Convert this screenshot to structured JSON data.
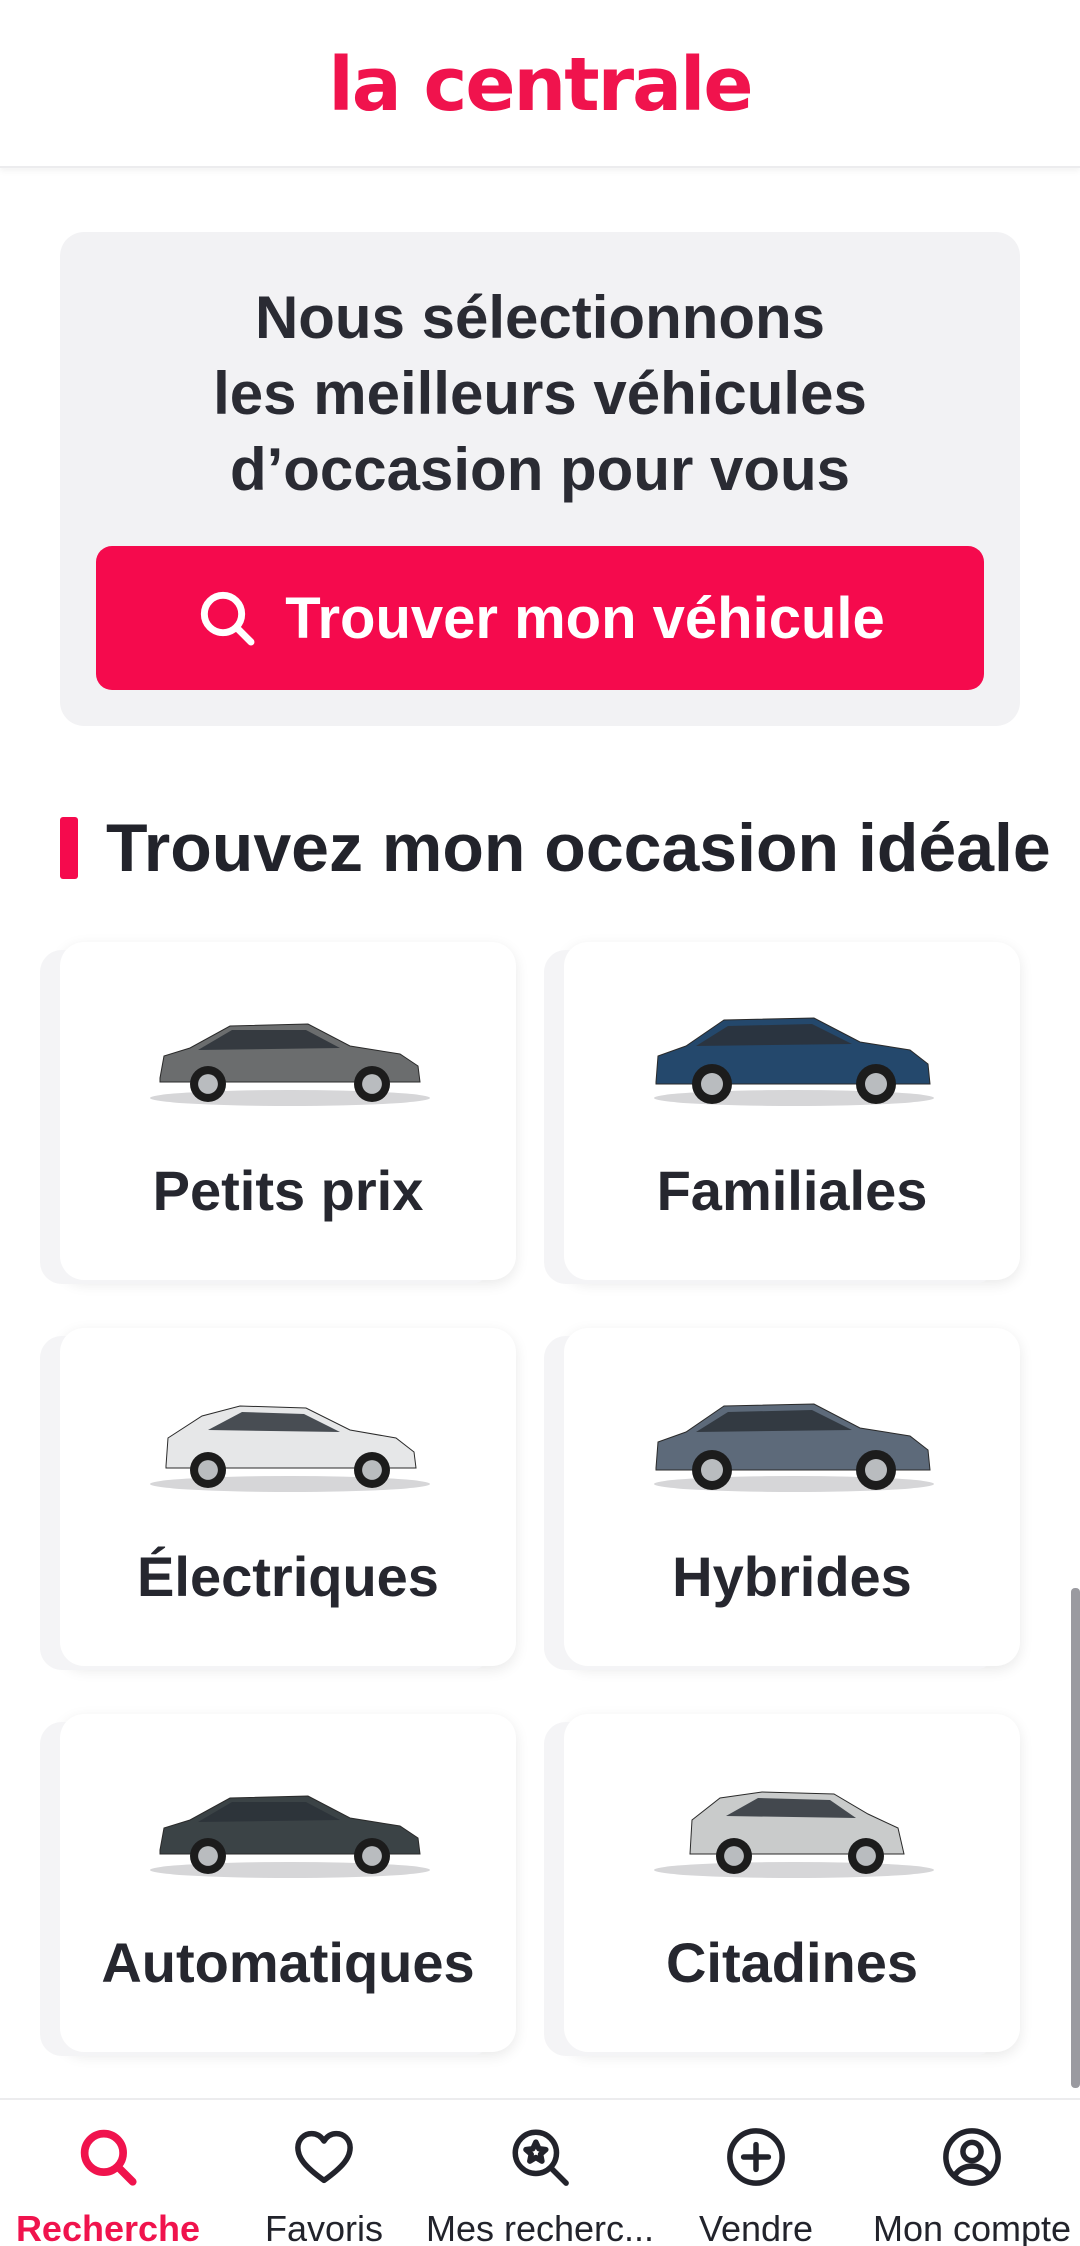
{
  "header": {
    "logo_text": "la centrale"
  },
  "hero": {
    "title_lines": [
      "Nous sélectionnons",
      "les meilleurs véhicules",
      "d’occasion pour vous"
    ],
    "cta_label": "Trouver mon véhicule"
  },
  "section": {
    "title": "Trouvez mon occasion idéale"
  },
  "categories": [
    {
      "label": "Petits prix",
      "car_color": "#6b6d6e",
      "car_type": "hatchback"
    },
    {
      "label": "Familiales",
      "car_color": "#24486c",
      "car_type": "suv"
    },
    {
      "label": "Électriques",
      "car_color": "#e6e7e8",
      "car_type": "compact"
    },
    {
      "label": "Hybrides",
      "car_color": "#5d6a7a",
      "car_type": "suv"
    },
    {
      "label": "Automatiques",
      "car_color": "#3b4346",
      "car_type": "hatchback"
    },
    {
      "label": "Citadines",
      "car_color": "#c9cbcb",
      "car_type": "city"
    }
  ],
  "tabbar": [
    {
      "label": "Recherche",
      "icon": "search-icon",
      "active": true
    },
    {
      "label": "Favoris",
      "icon": "heart-icon",
      "active": false
    },
    {
      "label": "Mes recherc...",
      "icon": "saved-search-icon",
      "active": false
    },
    {
      "label": "Vendre",
      "icon": "plus-circle-icon",
      "active": false
    },
    {
      "label": "Mon compte",
      "icon": "user-circle-icon",
      "active": false
    }
  ],
  "colors": {
    "accent": "#f50a4d",
    "logo": "#f0134d",
    "hero_bg": "#f2f2f4",
    "text": "#22232b"
  }
}
